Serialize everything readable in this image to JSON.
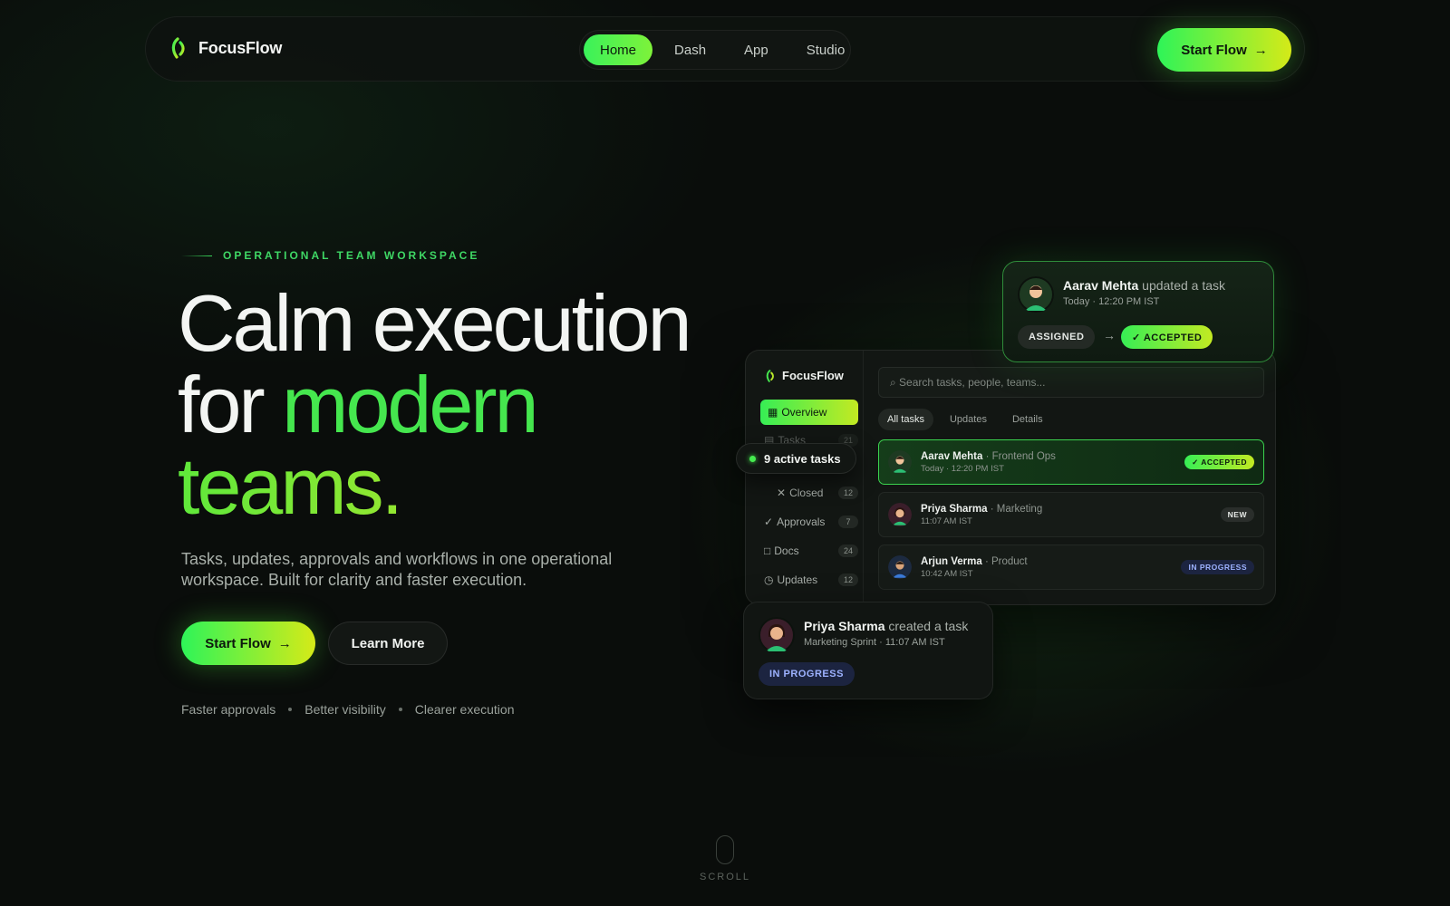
{
  "nav": {
    "brand": "FocusFlow",
    "items": [
      {
        "label": "Home",
        "active": true
      },
      {
        "label": "Dash",
        "active": false
      },
      {
        "label": "App",
        "active": false
      },
      {
        "label": "Studio",
        "active": false
      }
    ],
    "cta": "Start Flow",
    "cta_arrow": "→"
  },
  "hero": {
    "eyebrow": "OPERATIONAL TEAM WORKSPACE",
    "headline_1": "Calm execution",
    "headline_2a": "for ",
    "headline_2b": "modern",
    "headline_3": "teams.",
    "subtitle": "Tasks, updates, approvals and workflows in one operational workspace. Built for clarity and faster execution.",
    "primary_cta": "Start Flow",
    "primary_arrow": "→",
    "secondary_cta": "Learn More",
    "features": [
      "Faster approvals",
      "Better visibility",
      "Clearer execution"
    ]
  },
  "mock": {
    "brand": "FocusFlow",
    "sidebar": [
      {
        "icon": "▦",
        "label": "Overview",
        "count": ""
      },
      {
        "icon": "▤",
        "label": "Tasks",
        "count": "21"
      },
      {
        "icon": "✕",
        "label": "Closed",
        "count": "12"
      },
      {
        "icon": "✓",
        "label": "Approvals",
        "count": "7"
      },
      {
        "icon": "□",
        "label": "Docs",
        "count": "24"
      },
      {
        "icon": "◷",
        "label": "Updates",
        "count": "12"
      }
    ],
    "search_placeholder": "⌕ Search tasks, people, teams...",
    "tabs": [
      "All tasks",
      "Updates",
      "Details"
    ],
    "rows": [
      {
        "name": "Aarav Mehta",
        "role": " · Frontend Ops",
        "time": "Today · 12:20 PM IST",
        "status": "✓ ACCEPTED"
      },
      {
        "name": "Priya Sharma",
        "role": " · Marketing",
        "time": "11:07 AM IST",
        "status": "NEW"
      },
      {
        "name": "Arjun Verma",
        "role": " · Product",
        "time": "10:42 AM IST",
        "status": "IN PROGRESS"
      }
    ],
    "active_tasks": "9 active tasks"
  },
  "card_top": {
    "name": "Aarav Mehta",
    "action": " updated a task",
    "time": "Today · 12:20 PM IST",
    "from": "ASSIGNED",
    "arrow": "→",
    "to": "✓ ACCEPTED"
  },
  "card_bottom": {
    "name": "Priya Sharma",
    "action": " created a task",
    "meta": "Marketing Sprint · 11:07 AM IST",
    "status": "IN PROGRESS"
  },
  "scroll": "SCROLL",
  "colors": {
    "accent_green": "#3af25a",
    "accent_lime": "#d5ea18",
    "progress_blue": "#9db2ff"
  }
}
